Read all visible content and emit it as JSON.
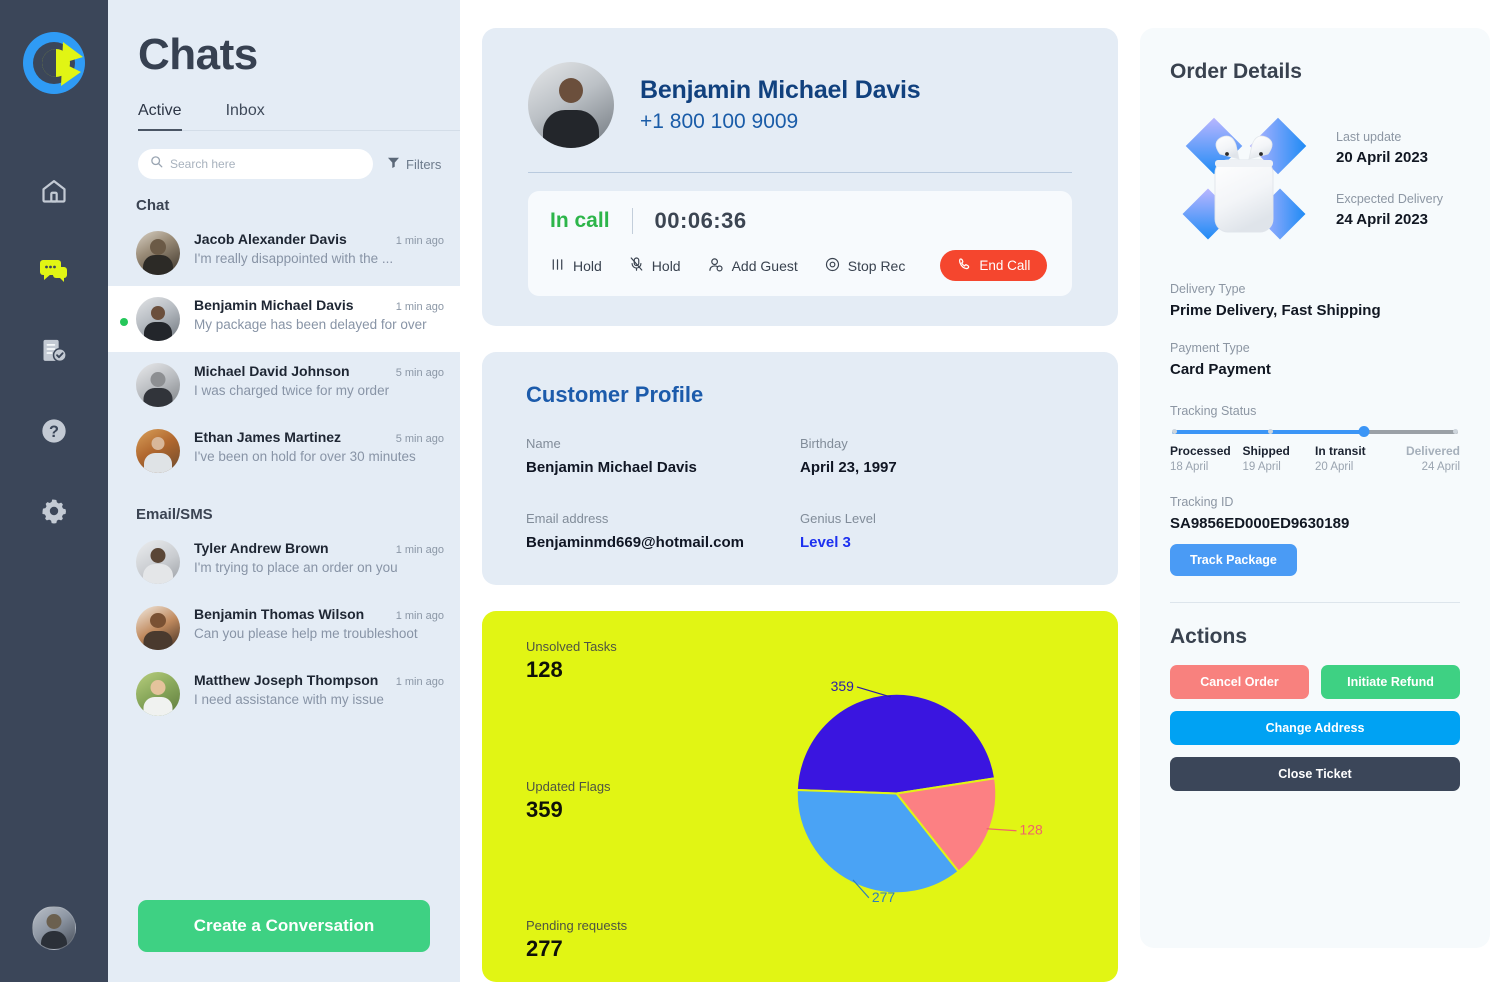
{
  "rail": {
    "logo_name": "brand-logo",
    "items": [
      {
        "icon": "home-icon",
        "name": "home",
        "active": false
      },
      {
        "icon": "chat-icon",
        "name": "chats",
        "active": true
      },
      {
        "icon": "document-check-icon",
        "name": "reports",
        "active": false
      },
      {
        "icon": "help-icon",
        "name": "help",
        "active": false
      },
      {
        "icon": "gear-icon",
        "name": "settings",
        "active": false
      }
    ],
    "avatar_name": "user-avatar"
  },
  "chatlist": {
    "title": "Chats",
    "tabs": [
      {
        "label": "Active",
        "active": true
      },
      {
        "label": "Inbox",
        "active": false
      }
    ],
    "search": {
      "placeholder": "Search here",
      "value": "",
      "icon": "search-icon"
    },
    "filters": {
      "label": "Filters",
      "icon": "filter-icon"
    },
    "groups": [
      {
        "label": "Chat",
        "rows": [
          {
            "name": "Jacob Alexander Davis",
            "time": "1 min ago",
            "message": "I'm really disappointed with the  ...",
            "active": false
          },
          {
            "name": "Benjamin Michael Davis",
            "time": "1 min ago",
            "message": "My package has been delayed for over",
            "active": true
          },
          {
            "name": "Michael David Johnson",
            "time": "5 min ago",
            "message": "I was charged twice for my order",
            "active": false
          },
          {
            "name": "Ethan James Martinez",
            "time": "5 min ago",
            "message": "I've been on hold for over 30 minutes",
            "active": false
          }
        ]
      },
      {
        "label": "Email/SMS",
        "rows": [
          {
            "name": "Tyler Andrew Brown",
            "time": "1 min ago",
            "message": "I'm trying to place an order on you",
            "active": false
          },
          {
            "name": "Benjamin Thomas Wilson",
            "time": "1 min ago",
            "message": "Can you please help me troubleshoot",
            "active": false
          },
          {
            "name": "Matthew Joseph Thompson",
            "time": "1 min ago",
            "message": "I need assistance with my issue",
            "active": false
          }
        ]
      }
    ],
    "cta_label": "Create a Conversation"
  },
  "call": {
    "contact_name": "Benjamin Michael Davis",
    "phone": "+1 800 100 9009",
    "status": "In call",
    "timer": "00:06:36",
    "actions": [
      {
        "label": "Hold",
        "icon": "pause-icon"
      },
      {
        "label": "Hold",
        "icon": "mic-off-icon"
      },
      {
        "label": "Add Guest",
        "icon": "add-user-icon"
      },
      {
        "label": "Stop Rec",
        "icon": "record-icon"
      }
    ],
    "end_call": {
      "label": "End Call",
      "icon": "phone-hangup-icon",
      "color": "#f5462e"
    }
  },
  "profile": {
    "title": "Customer Profile",
    "fields": [
      {
        "label": "Name",
        "value": "Benjamin Michael Davis"
      },
      {
        "label": "Birthday",
        "value": "April 23, 1997"
      },
      {
        "label": "Email address",
        "value": "Benjaminmd669@hotmail.com"
      },
      {
        "label": "Genius Level",
        "value": "Level 3",
        "accent": "#1d31f0"
      }
    ]
  },
  "stats": {
    "items": [
      {
        "label": "Unsolved Tasks",
        "value": "128"
      },
      {
        "label": "Updated Flags",
        "value": "359"
      },
      {
        "label": "Pending requests",
        "value": "277"
      }
    ]
  },
  "chart_data": {
    "type": "pie",
    "title": "",
    "labels": [
      "359",
      "128",
      "277"
    ],
    "categories": [
      "Updated Flags",
      "Unsolved Tasks",
      "Pending requests"
    ],
    "values": [
      359,
      128,
      277
    ],
    "colors": [
      "#3a15e0",
      "#fc8083",
      "#4aa3f5"
    ],
    "label_colors": [
      "#2b1ba8",
      "#f0636b",
      "#2f7fb8"
    ],
    "background": "#e1f514",
    "legend": "none",
    "annotations": [
      {
        "text": "359",
        "position": "upper-left"
      },
      {
        "text": "128",
        "position": "right"
      },
      {
        "text": "277",
        "position": "bottom-right"
      }
    ]
  },
  "order": {
    "title": "Order Details",
    "product_icon": "airpods-product-image",
    "meta": [
      {
        "label": "Last update",
        "value": "20 April 2023"
      },
      {
        "label": "Excpected Delivery",
        "value": "24 April 2023"
      }
    ],
    "delivery_type": {
      "label": "Delivery Type",
      "value": "Prime Delivery, Fast Shipping"
    },
    "payment_type": {
      "label": "Payment Type",
      "value": "Card Payment"
    },
    "tracking": {
      "label": "Tracking Status",
      "progress_percent": 67,
      "steps": [
        {
          "name": "Processed",
          "date": "18 April",
          "done": true
        },
        {
          "name": "Shipped",
          "date": "19 April",
          "done": true
        },
        {
          "name": "In transit",
          "date": "20 April",
          "done": true
        },
        {
          "name": "Delivered",
          "date": "24 April",
          "done": false
        }
      ]
    },
    "tracking_id": {
      "label": "Tracking ID",
      "value": "SA9856ED000ED9630189"
    },
    "track_button": "Track Package"
  },
  "actions": {
    "title": "Actions",
    "cancel": "Cancel Order",
    "refund": "Initiate Refund",
    "address": "Change Address",
    "close": "Close Ticket"
  }
}
